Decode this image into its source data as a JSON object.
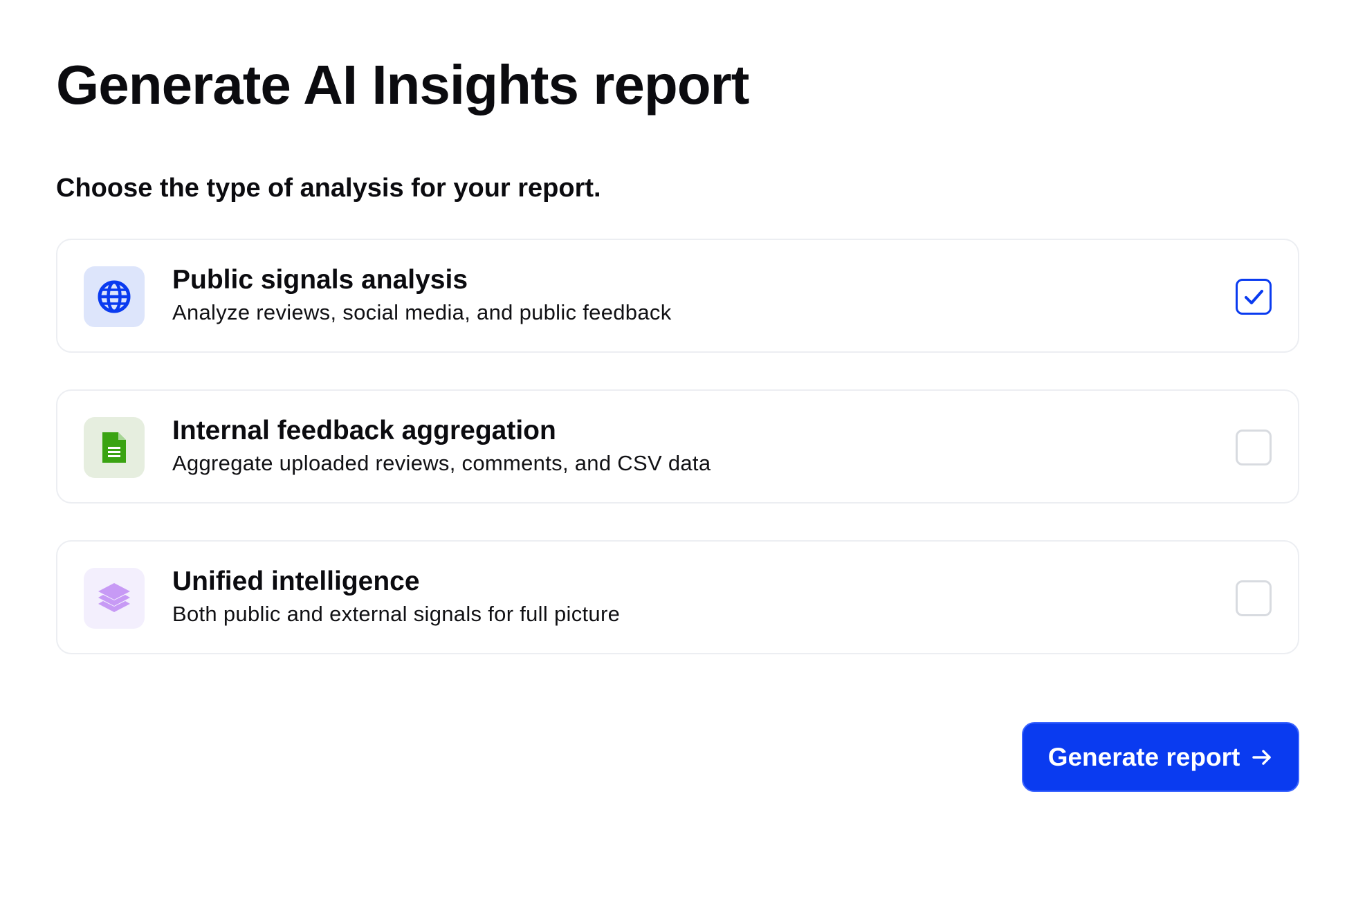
{
  "page": {
    "title": "Generate AI Insights report",
    "prompt": "Choose the type of analysis for your report."
  },
  "options": [
    {
      "title": "Public signals analysis",
      "description": "Analyze reviews, social media, and public feedback",
      "icon": "globe-icon",
      "icon_color": "#0a3bf0",
      "icon_bg": "#dde5fb",
      "selected": true
    },
    {
      "title": "Internal feedback aggregation",
      "description": "Aggregate uploaded reviews, comments, and CSV data",
      "icon": "document-icon",
      "icon_color": "#3aa312",
      "icon_bg": "#e6eedf",
      "selected": false
    },
    {
      "title": "Unified intelligence",
      "description": "Both public and external signals for full picture",
      "icon": "layers-icon",
      "icon_color": "#c79af5",
      "icon_bg": "#f3effd",
      "selected": false
    }
  ],
  "actions": {
    "generate_label": "Generate report"
  },
  "colors": {
    "accent": "#0a3bf0",
    "card_border": "#eceef2",
    "checkbox_border": "#d8dbe0"
  }
}
